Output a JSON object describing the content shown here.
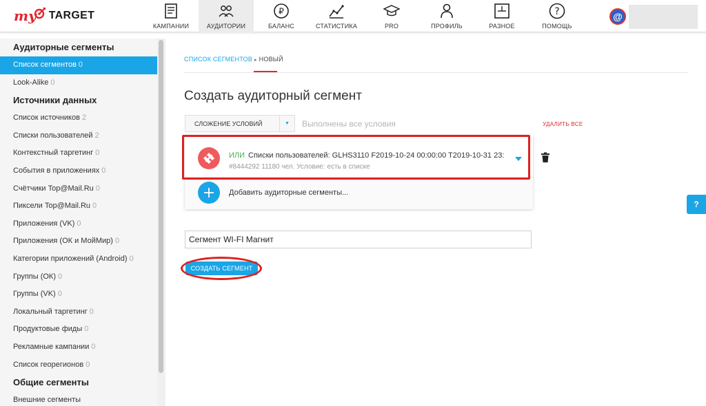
{
  "brand": {
    "my": "my",
    "target": "TARGET",
    "accent": "#e3262f",
    "primary": "#1aa5e6"
  },
  "nav": [
    {
      "label": "КАМПАНИИ",
      "icon": "campaigns-icon",
      "active": false
    },
    {
      "label": "АУДИТОРИИ",
      "icon": "audiences-icon",
      "active": true
    },
    {
      "label": "БАЛАНС",
      "icon": "balance-icon",
      "active": false
    },
    {
      "label": "СТАТИСТИКА",
      "icon": "statistics-icon",
      "active": false
    },
    {
      "label": "PRO",
      "icon": "pro-icon",
      "active": false
    },
    {
      "label": "ПРОФИЛЬ",
      "icon": "profile-icon",
      "active": false
    },
    {
      "label": "РАЗНОЕ",
      "icon": "misc-icon",
      "active": false
    },
    {
      "label": "ПОМОЩЬ",
      "icon": "help-icon",
      "active": false
    }
  ],
  "user": {
    "avatar_glyph": "@"
  },
  "sidebar": {
    "sections": [
      {
        "title": "Аудиторные сегменты",
        "items": [
          {
            "label": "Список сегментов",
            "count": "0",
            "active": true
          },
          {
            "label": "Look-Alike",
            "count": "0"
          }
        ]
      },
      {
        "title": "Источники данных",
        "items": [
          {
            "label": "Список источников",
            "count": "2"
          },
          {
            "label": "Списки пользователей",
            "count": "2"
          },
          {
            "label": "Контекстный таргетинг",
            "count": "0"
          },
          {
            "label": "События в приложениях",
            "count": "0"
          },
          {
            "label": "Счётчики Top@Mail.Ru",
            "count": "0"
          },
          {
            "label": "Пиксели Top@Mail.Ru",
            "count": "0"
          },
          {
            "label": "Приложения (VK)",
            "count": "0"
          },
          {
            "label": "Приложения (ОК и МойМир)",
            "count": "0"
          },
          {
            "label": "Категории приложений (Android)",
            "count": "0"
          },
          {
            "label": "Группы (ОК)",
            "count": "0"
          },
          {
            "label": "Группы (VK)",
            "count": "0"
          },
          {
            "label": "Локальный таргетинг",
            "count": "0"
          },
          {
            "label": "Продуктовые фиды",
            "count": "0"
          },
          {
            "label": "Рекламные кампании",
            "count": "0"
          },
          {
            "label": "Список георегионов",
            "count": "0"
          }
        ]
      },
      {
        "title": "Общие сегменты",
        "items": [
          {
            "label": "Внешние сегменты",
            "count": ""
          }
        ]
      }
    ]
  },
  "breadcrumb": {
    "link": "СПИСОК СЕГМЕНТОВ",
    "separator": "▸",
    "current": "НОВЫЙ"
  },
  "page_title": "Создать аудиторный сегмент",
  "conditions": {
    "select_value": "СЛОЖЕНИЕ УСЛОВИЙ",
    "select_arrow": "▼",
    "hint": "Выполнены все условия",
    "delete_all": "УДАЛИТЬ ВСЕ"
  },
  "segment": {
    "operator": "ИЛИ",
    "description": "Списки пользователей:  GLHS3110 F2019-10-24 00:00:00 T2019-10-31 23:...",
    "meta": "#8444292  11180 чел.  Условие: есть в списке"
  },
  "add_segments_label": "Добавить аудиторные сегменты...",
  "name_field": {
    "value": "Сегмент WI-FI Магнит"
  },
  "create_button": "СОЗДАТЬ СЕГМЕНТ",
  "help_button": "?"
}
